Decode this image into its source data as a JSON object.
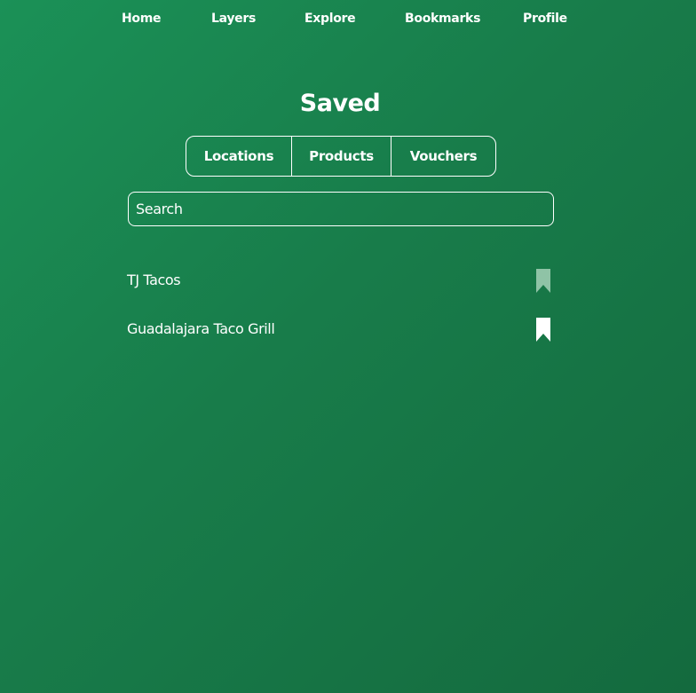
{
  "nav": {
    "items": [
      {
        "label": "Home"
      },
      {
        "label": "Layers"
      },
      {
        "label": "Explore"
      },
      {
        "label": "Bookmarks"
      },
      {
        "label": "Profile"
      }
    ]
  },
  "page": {
    "title": "Saved"
  },
  "tabs": [
    {
      "label": "Locations",
      "selected": true
    },
    {
      "label": "Products",
      "selected": false
    },
    {
      "label": "Vouchers",
      "selected": false
    }
  ],
  "search": {
    "placeholder": "Search",
    "value": ""
  },
  "saved_items": [
    {
      "name": "TJ Tacos",
      "bookmark_icon": "bookmark-icon",
      "bookmark_color": "#8fc3a6"
    },
    {
      "name": "Guadalajara Taco Grill",
      "bookmark_icon": "bookmark-icon",
      "bookmark_color": "#ffffff"
    }
  ],
  "colors": {
    "background_start": "#1b9157",
    "background_end": "#146a3e",
    "foreground": "#ffffff"
  }
}
